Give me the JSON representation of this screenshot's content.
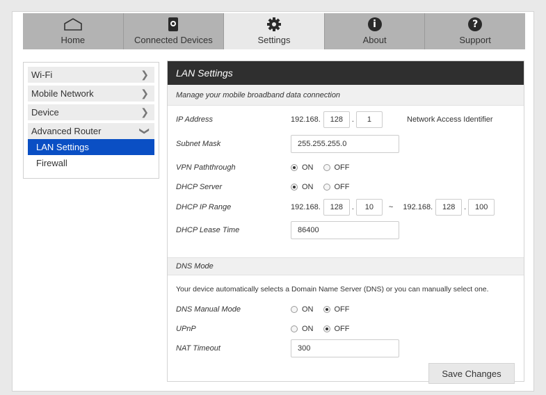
{
  "nav": {
    "tabs": [
      {
        "label": "Home",
        "icon": "home-icon"
      },
      {
        "label": "Connected Devices",
        "icon": "device-icon"
      },
      {
        "label": "Settings",
        "icon": "gear-icon"
      },
      {
        "label": "About",
        "icon": "info-icon"
      },
      {
        "label": "Support",
        "icon": "help-icon"
      }
    ],
    "active": "Settings"
  },
  "sidebar": {
    "items": [
      {
        "label": "Wi-Fi"
      },
      {
        "label": "Mobile Network"
      },
      {
        "label": "Device"
      },
      {
        "label": "Advanced Router"
      }
    ],
    "subitems": [
      {
        "label": "LAN Settings",
        "active": true
      },
      {
        "label": "Firewall"
      }
    ],
    "active_color": "#0a4fc4"
  },
  "panel": {
    "title": "LAN Settings",
    "subtitle": "Manage your mobile broadband data connection",
    "ip_address": {
      "label": "IP Address",
      "prefix": "192.168.",
      "octet3": "128",
      "octet4": "1",
      "note": "Network Access Identifier"
    },
    "subnet_mask": {
      "label": "Subnet Mask",
      "value": "255.255.255.0"
    },
    "vpn": {
      "label": "VPN Paththrough",
      "on_label": "ON",
      "off_label": "OFF",
      "selected": "ON"
    },
    "dhcp_server": {
      "label": "DHCP Server",
      "on_label": "ON",
      "off_label": "OFF",
      "selected": "ON"
    },
    "dhcp_range": {
      "label": "DHCP IP Range",
      "start_prefix": "192.168.",
      "start_octet3": "128",
      "start_octet4": "10",
      "separator": "~",
      "end_prefix": "192.168.",
      "end_octet3": "128",
      "end_octet4": "100"
    },
    "lease_time": {
      "label": "DHCP Lease Time",
      "value": "86400"
    },
    "dns_mode": {
      "header": "DNS Mode",
      "description": "Your device automatically selects a Domain Name Server (DNS) or you can manually select one.",
      "manual": {
        "label": "DNS Manual Mode",
        "on_label": "ON",
        "off_label": "OFF",
        "selected": "OFF"
      }
    },
    "upnp": {
      "label": "UPnP",
      "on_label": "ON",
      "off_label": "OFF",
      "selected": "OFF"
    },
    "nat_timeout": {
      "label": "NAT Timeout",
      "value": "300"
    },
    "save_label": "Save Changes"
  }
}
